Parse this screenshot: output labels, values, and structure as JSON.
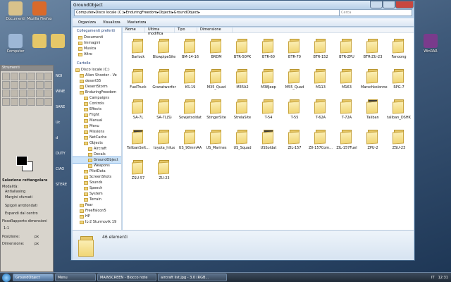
{
  "desktop": {
    "icons": [
      {
        "label": "Documenti",
        "color": "#d9c28b"
      },
      {
        "label": "Mozilla Firefox",
        "color": "#d96a2b"
      },
      {
        "label": "Computer",
        "color": "#9db7d6"
      },
      {
        "label": "",
        "color": "#e6c768"
      },
      {
        "label": "",
        "color": "#e6c768"
      },
      {
        "label": "Cestino",
        "color": "#b8c4cc"
      }
    ],
    "right_icon": "WinRAR"
  },
  "gimp": {
    "title": "Strumenti",
    "section": "Selezione rettangolare",
    "options": [
      "Modalità:",
      "Antialiasing",
      "Margini sfumati",
      "Spigoli arrotondati",
      "Espandi dal centro",
      "Fisso",
      "Rapporto dimensioni",
      "1:1",
      "Posizione:",
      "Dimensione:",
      "px",
      "px"
    ],
    "side_texts": [
      "NOI",
      "WINE",
      "SARE",
      "Uc",
      "d",
      "DUTY",
      "CIAO",
      "STERE"
    ]
  },
  "window": {
    "title": "GroundObject",
    "address": [
      "Computer",
      "Disco locale (C:)",
      "EnduringFreedom",
      "Objects",
      "GroundObject"
    ],
    "search_placeholder": "Cerca",
    "toolbar": [
      "Organizza",
      "Visualizza",
      "Masterizza"
    ],
    "nav": {
      "preferiti_header": "Collegamenti preferiti",
      "preferiti": [
        "Documenti",
        "Immagini",
        "Musica",
        "Altro"
      ],
      "cartelle_header": "Cartelle",
      "tree": [
        "Disco locale (C:)",
        "Alien Shooter - Ve",
        "desert55",
        "DesertStorm",
        "EnduringFreedom",
        "Campaigns",
        "Controls",
        "Effects",
        "Flight",
        "Manual",
        "Menu",
        "Missions",
        "NetCache",
        "Objects",
        "Aircraft",
        "Decals",
        "GroundObject",
        "Weapons",
        "PilotData",
        "ScreenShots",
        "Sounds",
        "Speech",
        "System",
        "Terrain",
        "Fear",
        "FreeFalcon5",
        "HP",
        "IL-2 Sturmovik 19"
      ],
      "selected": "GroundObject"
    },
    "columns": [
      "Nome",
      "Ultima modifica",
      "Tipo",
      "Dimensione"
    ],
    "folders": [
      "Barlock",
      "BlowpipeSite",
      "BM-14-16",
      "BRDM",
      "BTR-50PK",
      "BTR-60",
      "BTR-70",
      "BTR-152",
      "BTR-ZPU",
      "BTR-ZU-23",
      "Fanoong",
      "FuelTruck",
      "Granatwerfer",
      "KS-19",
      "M35_Quad",
      "M35A2",
      "M38Jeep",
      "M55_Quad",
      "M113",
      "M163",
      "Marschkolonne",
      "RPG-7",
      "SA-7L",
      "SA-7L(S)",
      "Sowjetsoldat",
      "StingerSite",
      "StrelaSite",
      "T-54",
      "T-55",
      "T-62A",
      "T-72A",
      "Taliban",
      "taliban_DSHK",
      "TalibanSelt...",
      "toyota_hilux",
      "US_90mmAA",
      "US_Marines",
      "US_Squad",
      "USSoldat",
      "ZIL-157",
      "ZIl-157Com...",
      "ZIL-157Fuel",
      "ZPU-2",
      "ZSU-23",
      "ZSU-57",
      "ZU-23"
    ],
    "dark_folders": [
      "Taliban",
      "TalibanSelt...",
      "USSoldat"
    ],
    "count": "46 elementi"
  },
  "taskbar": {
    "buttons": [
      "GroundObject",
      "Menu",
      "MAINSCREEN - Blocco note",
      "aircraft list.jpg - 3.0 (RGB..."
    ],
    "active": "GroundObject",
    "lang": "IT",
    "time": "12:31"
  }
}
